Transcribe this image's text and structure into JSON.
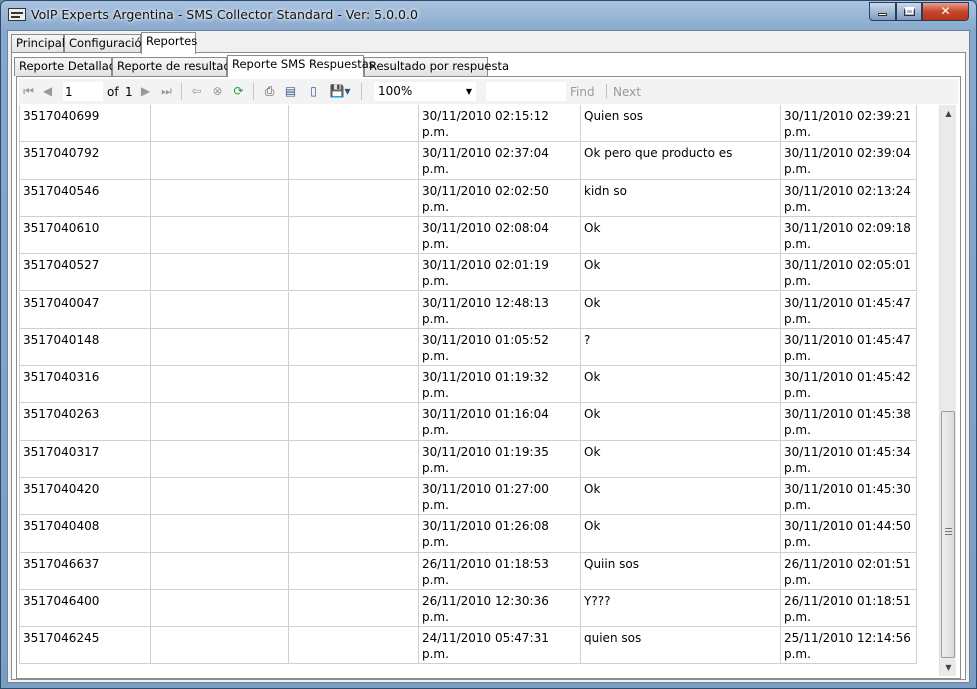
{
  "window": {
    "title": "VoIP Experts Argentina - SMS Collector Standard - Ver: 5.0.0.0",
    "controls": {
      "minimize": "",
      "maximize": "",
      "close": "✕"
    }
  },
  "main_tabs": [
    {
      "label": "Principal",
      "active": false
    },
    {
      "label": "Configuración",
      "active": false
    },
    {
      "label": "Reportes",
      "active": true
    }
  ],
  "report_tabs": [
    {
      "label": "Reporte Detallado",
      "active": false
    },
    {
      "label": "Reporte de resultados",
      "active": false
    },
    {
      "label": "Reporte SMS Respuestas",
      "active": true
    },
    {
      "label": "Resultado por respuesta",
      "active": false
    }
  ],
  "toolbar": {
    "page_value": "1",
    "of_label": "of",
    "page_count": "1",
    "zoom": "100%",
    "find_label": "Find",
    "next_label": "Next",
    "icons": [
      "first-page-icon",
      "previous-page-icon",
      "next-page-icon",
      "last-page-icon",
      "back-icon",
      "stop-icon",
      "refresh-icon",
      "print-icon",
      "print-layout-icon",
      "page-setup-icon",
      "export-icon"
    ]
  },
  "report": {
    "top_fragment": "'",
    "rows": [
      [
        "3517040699",
        "",
        "",
        "30/11/2010 02:15:12 p.m.",
        "Quien sos",
        "30/11/2010 02:39:21\np.m."
      ],
      [
        "3517040792",
        "",
        "",
        "30/11/2010 02:37:04 p.m.",
        "Ok pero que producto es",
        "30/11/2010 02:39:04\np.m."
      ],
      [
        "3517040546",
        "",
        "",
        "30/11/2010 02:02:50 p.m.",
        "kidn so",
        "30/11/2010 02:13:24\np.m."
      ],
      [
        "3517040610",
        "",
        "",
        "30/11/2010 02:08:04 p.m.",
        "Ok",
        "30/11/2010 02:09:18\np.m."
      ],
      [
        "3517040527",
        "",
        "",
        "30/11/2010 02:01:19 p.m.",
        "Ok",
        "30/11/2010 02:05:01\np.m."
      ],
      [
        "3517040047",
        "",
        "",
        "30/11/2010 12:48:13 p.m.",
        "Ok",
        "30/11/2010 01:45:47\np.m."
      ],
      [
        "3517040148",
        "",
        "",
        "30/11/2010 01:05:52 p.m.",
        "?",
        "30/11/2010 01:45:47\np.m."
      ],
      [
        "3517040316",
        "",
        "",
        "30/11/2010 01:19:32 p.m.",
        "Ok",
        "30/11/2010 01:45:42\np.m."
      ],
      [
        "3517040263",
        "",
        "",
        "30/11/2010 01:16:04 p.m.",
        "Ok",
        "30/11/2010 01:45:38\np.m."
      ],
      [
        "3517040317",
        "",
        "",
        "30/11/2010 01:19:35 p.m.",
        "Ok",
        "30/11/2010 01:45:34\np.m."
      ],
      [
        "3517040420",
        "",
        "",
        "30/11/2010 01:27:00 p.m.",
        "Ok",
        "30/11/2010 01:45:30\np.m."
      ],
      [
        "3517040408",
        "",
        "",
        "30/11/2010 01:26:08 p.m.",
        "Ok",
        "30/11/2010 01:44:50\np.m."
      ],
      [
        "3517046637",
        "",
        "",
        "26/11/2010 01:18:53 p.m.",
        "Quiin sos",
        "26/11/2010 02:01:51\np.m."
      ],
      [
        "3517046400",
        "",
        "",
        "26/11/2010 12:30:36 p.m.",
        "Y???",
        "26/11/2010 01:18:51\np.m."
      ],
      [
        "3517046245",
        "",
        "",
        "24/11/2010 05:47:31 p.m.",
        "quien sos",
        "25/11/2010 12:14:56\np.m."
      ]
    ]
  }
}
